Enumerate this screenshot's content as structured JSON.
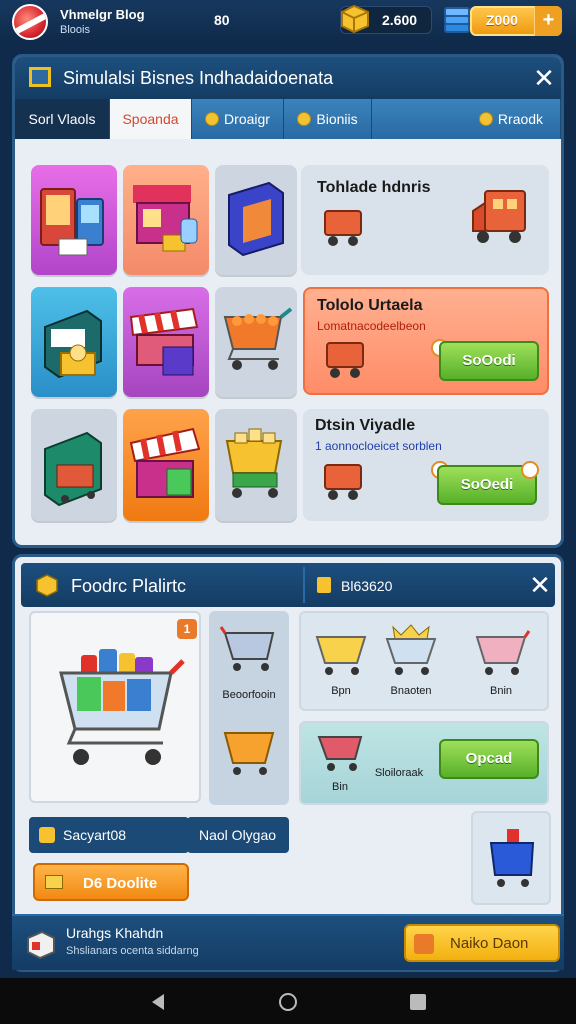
{
  "hud": {
    "player_name": "Vhmelgr Blog",
    "player_sub": "Bloois",
    "level": "80",
    "coins": "2.600",
    "gems": "Z000",
    "plus": "+"
  },
  "panel1": {
    "title": "Simulalsi Bisnes Indhadaidoenata",
    "tabs": [
      {
        "label": "Sorl Vlaols"
      },
      {
        "label": "Spoanda"
      },
      {
        "label": "Droaigr"
      },
      {
        "label": "Bioniis"
      },
      {
        "label": "Rraodk"
      }
    ],
    "cards": [
      {
        "title": "Tohlade hdnris"
      },
      {
        "title": "Tololo Urtaela",
        "subtitle": "Lomatnacodeelbeon",
        "button": "SoOodi"
      },
      {
        "title": "Dtsin Viyadle",
        "subtitle": "1 aonnocloeicet sorblen",
        "button": "SoOedi"
      }
    ],
    "colors": {
      "accent": "#2a6aa2",
      "orange_card": "#ff8c68",
      "green_button": "#58b02a"
    }
  },
  "panel2": {
    "title": "Foodrc Plalirtc",
    "code": "Bl63620",
    "cart_options": [
      {
        "label": "Beoorfooin"
      }
    ],
    "right_items": [
      {
        "label": "Bpn"
      },
      {
        "label": "Bnaoten"
      },
      {
        "label": "Bnin"
      }
    ],
    "promo": {
      "label": "Bin",
      "caption": "Sloiloraak",
      "button": "Opcad"
    },
    "bar_left": "Sacyart08",
    "bar_right": "Naol Olygao",
    "orange_button": "D6 Doolite",
    "badge": "1"
  },
  "footer": {
    "title": "Urahgs Khahdn",
    "subtitle": "Shslianars ocenta siddarng",
    "button": "Naiko Daon"
  }
}
